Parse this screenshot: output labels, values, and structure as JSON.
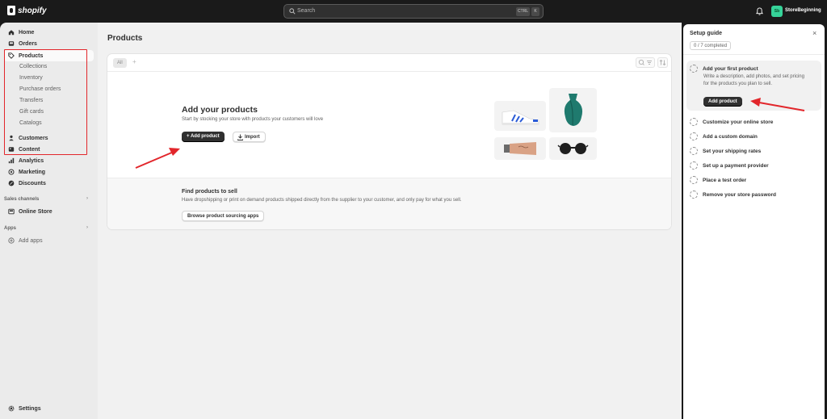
{
  "topbar": {
    "brand": "shopify",
    "search_placeholder": "Search",
    "shortcut_ctrl": "CTRL",
    "shortcut_key": "K",
    "store_initials": "Sb",
    "store_name": "StoreBeginning"
  },
  "sidebar": {
    "items": [
      {
        "label": "Home",
        "icon": "home-icon"
      },
      {
        "label": "Orders",
        "icon": "inbox-icon"
      },
      {
        "label": "Products",
        "icon": "tag-icon"
      },
      {
        "label": "Customers",
        "icon": "person-icon"
      },
      {
        "label": "Content",
        "icon": "image-icon"
      },
      {
        "label": "Analytics",
        "icon": "chart-icon"
      },
      {
        "label": "Marketing",
        "icon": "target-icon"
      },
      {
        "label": "Discounts",
        "icon": "discount-icon"
      }
    ],
    "product_subitems": [
      "Collections",
      "Inventory",
      "Purchase orders",
      "Transfers",
      "Gift cards",
      "Catalogs"
    ],
    "sales_channels_label": "Sales channels",
    "online_store_label": "Online Store",
    "apps_label": "Apps",
    "add_apps_label": "Add apps",
    "settings_label": "Settings"
  },
  "main": {
    "title": "Products",
    "tab_all": "All",
    "tab_add": "+",
    "empty_title": "Add your products",
    "empty_subtitle": "Start by stocking your store with products your customers will love",
    "add_product_label": "+ Add product",
    "import_label": "Import",
    "find_title": "Find products to sell",
    "find_subtitle": "Have dropshipping or print on demand products shipped directly from the supplier to your customer, and only pay for what you sell.",
    "browse_label": "Browse product sourcing apps"
  },
  "setup": {
    "title": "Setup guide",
    "close": "×",
    "progress": "0 / 7 completed",
    "active_step_title": "Add your first product",
    "active_step_desc": "Write a description, add photos, and set pricing for the products you plan to sell.",
    "active_step_button": "Add product",
    "steps": [
      "Customize your online store",
      "Add a custom domain",
      "Set your shipping rates",
      "Set up a payment provider",
      "Place a test order",
      "Remove your store password"
    ]
  },
  "colors": {
    "annotation": "#e2262b",
    "topbar": "#1a1a1a",
    "store_badge": "#36d399"
  }
}
